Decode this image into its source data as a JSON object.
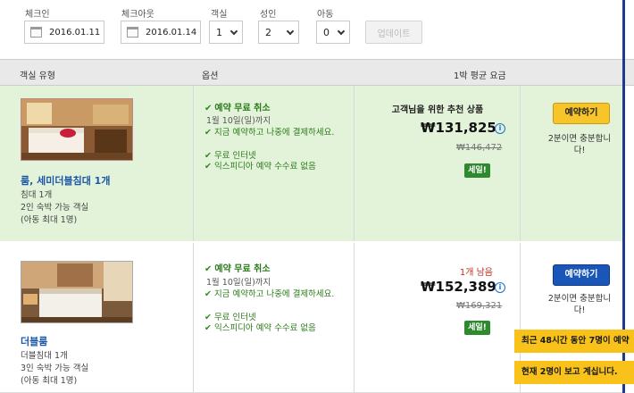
{
  "search": {
    "checkin_label": "체크인",
    "checkin_value": "2016.01.11",
    "checkout_label": "체크아웃",
    "checkout_value": "2016.01.14",
    "rooms_label": "객실",
    "rooms_value": "1",
    "adults_label": "성인",
    "adults_value": "2",
    "children_label": "아동",
    "children_value": "0",
    "update_label": "업데이트"
  },
  "table_head": {
    "room_type": "객실 유형",
    "options": "옵션",
    "avg_price": "1박 평균 요금"
  },
  "rooms": [
    {
      "name": "룸, 세미더블침대 1개",
      "details": [
        "침대 1개",
        "2인 숙박 가능 객실",
        "(아동 최대 1명)"
      ],
      "free_cancel": "예약 무료 취소",
      "cancel_until": "1월 10일(일)까지",
      "perks": [
        "지금 예약하고 나중에 결제하세요.",
        "무료 인터넷",
        "익스피디아 예약 수수료 없음"
      ],
      "price_tag": "고객님을 위한 추천 상품",
      "price": "₩131,825",
      "old_price": "₩146,472",
      "sale": "세일!",
      "book_label": "예약하기",
      "book_note": "2분이면 충분합니다!"
    },
    {
      "name": "더블룸",
      "details": [
        "더블침대 1개",
        "3인 숙박 가능 객실",
        "(아동 최대 1명)"
      ],
      "free_cancel": "예약 무료 취소",
      "cancel_until": "1월 10일(일)까지",
      "perks": [
        "지금 예약하고 나중에 결제하세요.",
        "무료 인터넷",
        "익스피디아 예약 수수료 없음"
      ],
      "rooms_left": "1개 남음",
      "price": "₩152,389",
      "old_price": "₩169,321",
      "sale": "세일!",
      "book_label": "예약하기",
      "book_note": "2분이면 충분합니다!"
    }
  ],
  "toasts": {
    "recent": "최근 48시간 동안 7명이 예약",
    "viewing": "현재 2명이 보고 계십니다."
  },
  "icons": {
    "info": "i",
    "check": "✔"
  },
  "colors": {
    "accent_blue": "#1a56b8",
    "book_yellow": "#f7c42a",
    "highlight_green": "#e3f3d9",
    "sale_green": "#2f8a2f",
    "alert_red": "#c0301e"
  }
}
